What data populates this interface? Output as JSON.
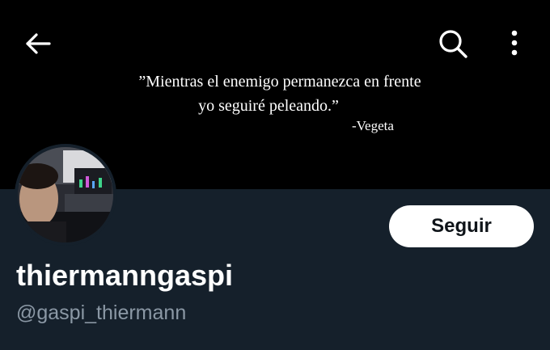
{
  "banner": {
    "quote_line1": "”Mientras el enemigo permanezca en frente",
    "quote_line2": "yo seguiré peleando.”",
    "quote_author": "-Vegeta"
  },
  "header": {
    "back_icon": "arrow-left-icon",
    "search_icon": "search-icon",
    "more_icon": "more-vertical-icon"
  },
  "profile": {
    "display_name": "thiermanngaspi",
    "handle": "@gaspi_thiermann",
    "follow_label": "Seguir"
  },
  "colors": {
    "background": "#15202b",
    "banner": "#000000",
    "handle_text": "#8b98a5",
    "button_bg": "#ffffff",
    "button_text": "#0f1419"
  }
}
